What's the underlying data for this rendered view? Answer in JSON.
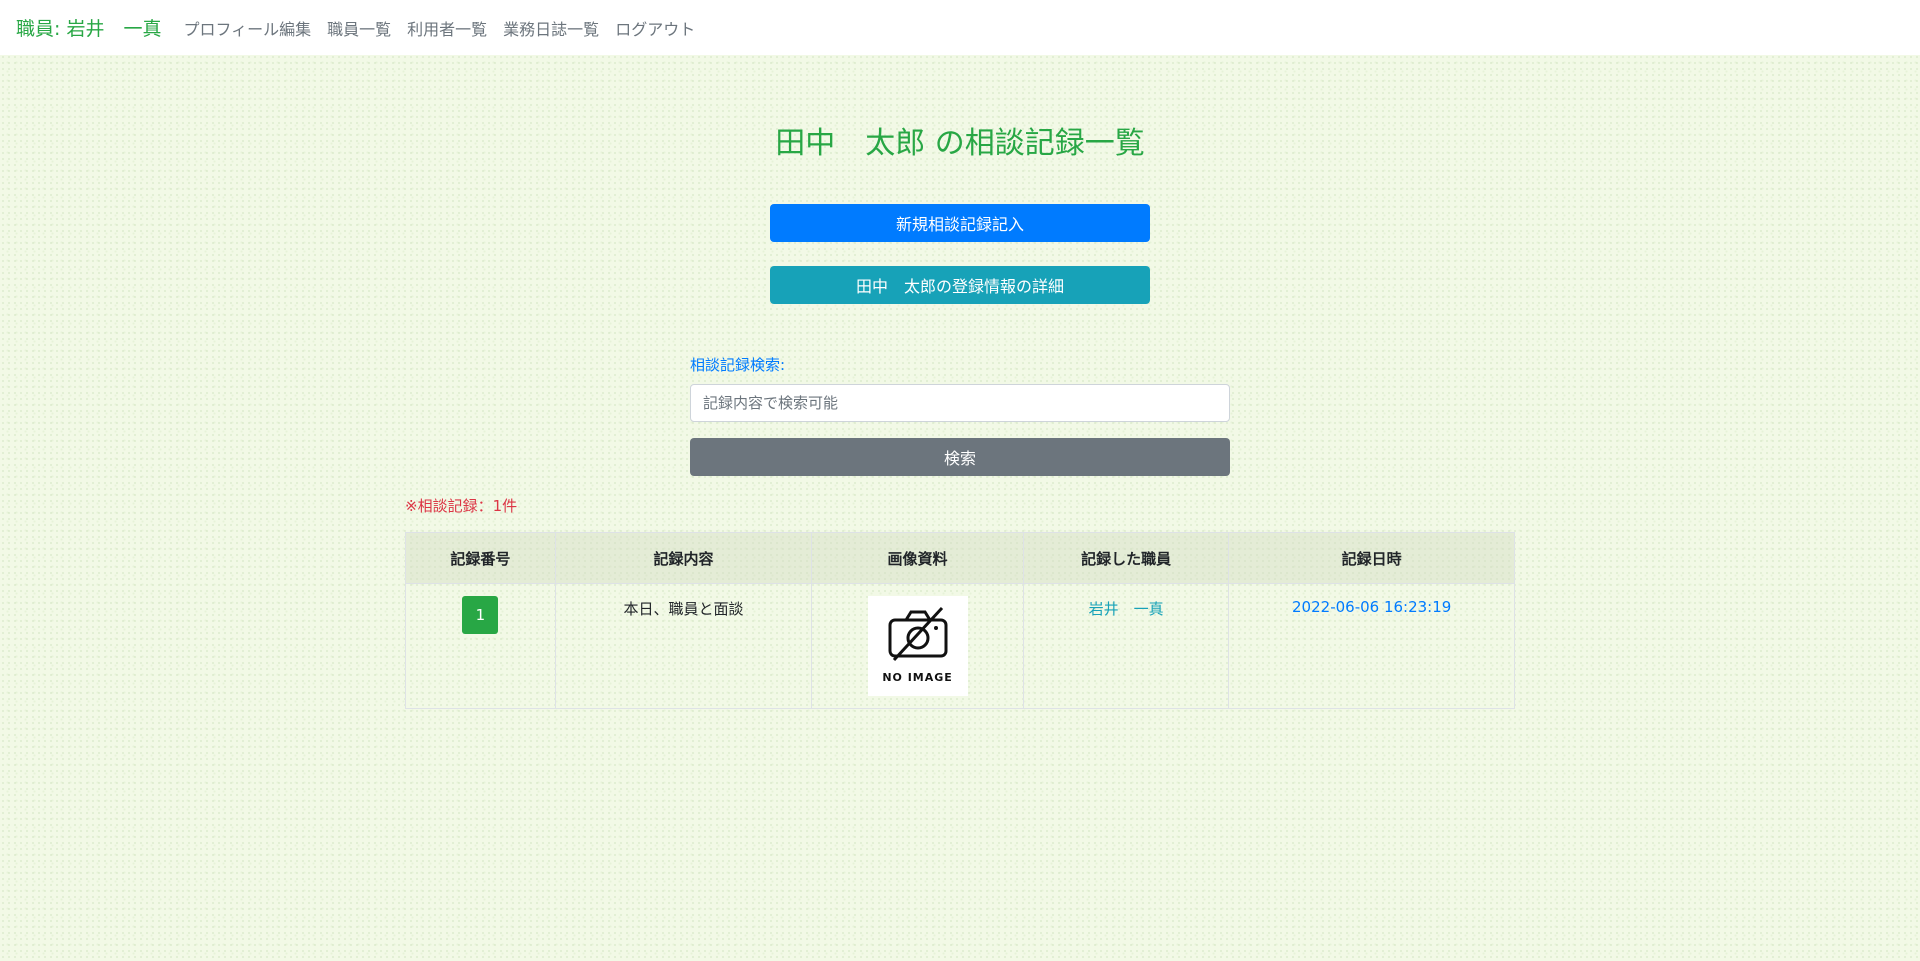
{
  "nav": {
    "brand": "職員: 岩井　一真",
    "links": [
      "プロフィール編集",
      "職員一覧",
      "利用者一覧",
      "業務日誌一覧",
      "ログアウト"
    ]
  },
  "page": {
    "title": "田中　太郎 の相談記録一覧",
    "new_record_button": "新規相談記録記入",
    "detail_button": "田中　太郎の登録情報の詳細"
  },
  "search": {
    "label": "相談記録検索:",
    "placeholder": "記録内容で検索可能",
    "button": "検索"
  },
  "records_count_note": "※相談記録：1件",
  "table": {
    "headers": [
      "記録番号",
      "記録内容",
      "画像資料",
      "記録した職員",
      "記録日時"
    ],
    "rows": [
      {
        "no": "1",
        "content": "本日、職員と面談",
        "image_text": "NO IMAGE",
        "staff": "岩井　一真",
        "datetime": "2022-06-06 16:23:19"
      }
    ]
  },
  "colors": {
    "brand_green": "#28a745",
    "primary": "#007bff",
    "info": "#17a2b8",
    "secondary": "#6c757d",
    "danger": "#dc3545"
  },
  "icons": [
    "no-image-camera-icon"
  ]
}
